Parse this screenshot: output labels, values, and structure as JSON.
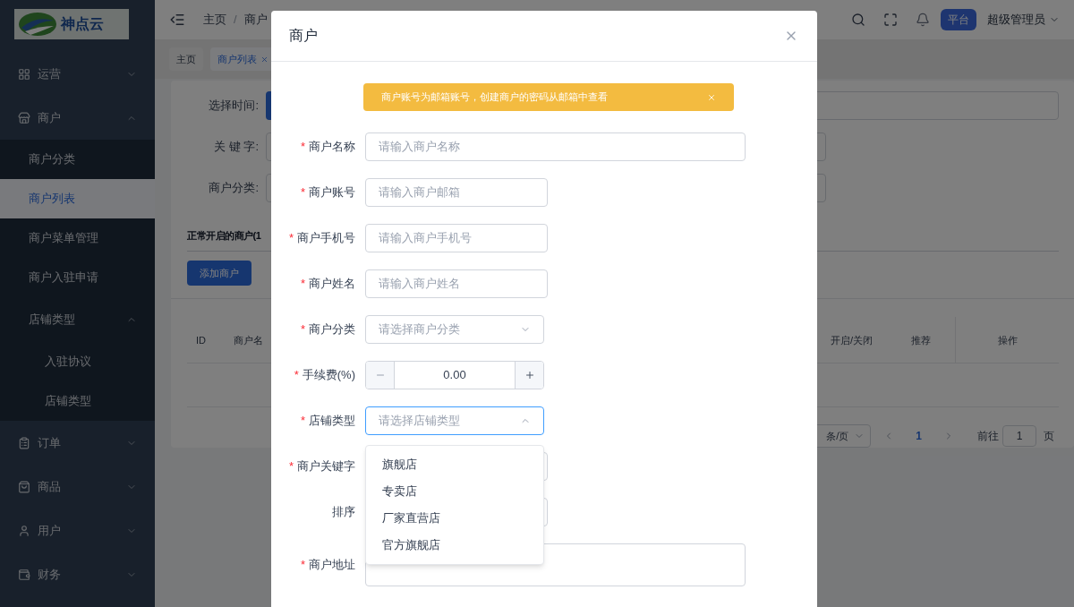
{
  "sidebar": {
    "logo_text": "神点云",
    "items": [
      {
        "label": "运营",
        "expanded": false
      },
      {
        "label": "商户",
        "expanded": true,
        "children": [
          {
            "label": "商户分类",
            "selected": false
          },
          {
            "label": "商户列表",
            "selected": true
          },
          {
            "label": "商户菜单管理",
            "selected": false
          },
          {
            "label": "商户入驻申请",
            "selected": false
          },
          {
            "label": "店铺类型",
            "selected": false,
            "expanded": true,
            "children": [
              {
                "label": "入驻协议",
                "selected": false
              },
              {
                "label": "店铺类型",
                "selected": false
              }
            ]
          }
        ]
      },
      {
        "label": "订单",
        "expanded": false
      },
      {
        "label": "商品",
        "expanded": false
      },
      {
        "label": "用户",
        "expanded": false
      },
      {
        "label": "财务",
        "expanded": false
      }
    ]
  },
  "header": {
    "breadcrumb": [
      "主页",
      "商户"
    ],
    "separator": "/",
    "badge": "平台",
    "user": "超级管理员"
  },
  "tabs": [
    {
      "label": "主页",
      "selected": false
    },
    {
      "label": "商户列表",
      "selected": true
    }
  ],
  "filters": [
    "选择时间:",
    "关 键 字:",
    "商户分类:"
  ],
  "section_title": "正常开启的商户(1",
  "add_button": "添加商户",
  "table": {
    "columns_left": [
      "ID",
      "商户名"
    ],
    "columns_right": [
      "开启/关闭",
      "推荐",
      "操作"
    ]
  },
  "pagination": {
    "page_size": "条/页",
    "pages": [
      {
        "label": "1",
        "selected": true
      }
    ],
    "goto_label": "前往",
    "goto_value": "1",
    "page_unit": "页"
  },
  "dialog": {
    "title": "商户",
    "required_mark": "*",
    "alert": "商户账号为邮箱账号，创建商户的密码从邮箱中查看",
    "fields": [
      {
        "kind": "text",
        "label": "商户名称",
        "required": true,
        "placeholder": "请输入商户名称",
        "wide": true
      },
      {
        "kind": "text",
        "label": "商户账号",
        "required": true,
        "placeholder": "请输入商户邮箱",
        "wide": false
      },
      {
        "kind": "text",
        "label": "商户手机号",
        "required": true,
        "placeholder": "请输入商户手机号",
        "wide": false
      },
      {
        "kind": "text",
        "label": "商户姓名",
        "required": true,
        "placeholder": "请输入商户姓名",
        "wide": false
      },
      {
        "kind": "select",
        "label": "商户分类",
        "required": true,
        "placeholder": "请选择商户分类",
        "open": false
      },
      {
        "kind": "number",
        "label": "手续费(%)",
        "required": true,
        "value": "0.00"
      },
      {
        "kind": "select",
        "label": "店铺类型",
        "required": true,
        "placeholder": "请选择店铺类型",
        "open": true,
        "options": [
          {
            "label": "旗舰店",
            "selected": false
          },
          {
            "label": "专卖店",
            "selected": false
          },
          {
            "label": "厂家直营店",
            "selected": false
          },
          {
            "label": "官方旗舰店",
            "selected": false
          }
        ]
      },
      {
        "kind": "text",
        "label": "商户关键字",
        "required": true,
        "wide": false
      },
      {
        "kind": "text",
        "label": "排序",
        "required": false,
        "wide": false
      },
      {
        "kind": "textarea",
        "label": "商户地址",
        "required": true
      }
    ]
  }
}
